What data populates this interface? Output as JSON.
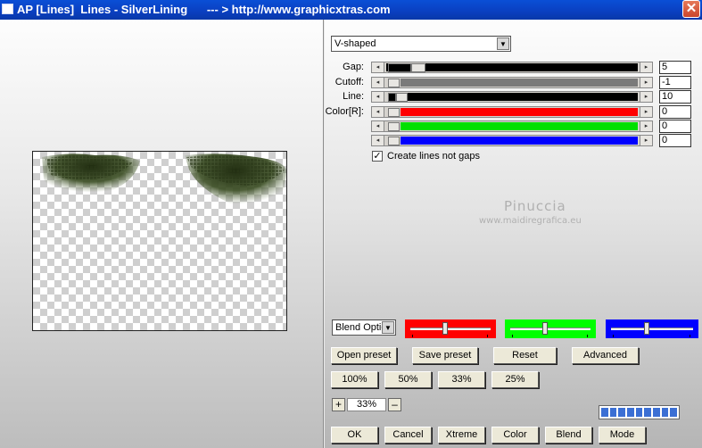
{
  "window": {
    "title": "AP [Lines]  Lines - SilverLining      --- > http://www.graphicxtras.com",
    "close_glyph": "✕"
  },
  "mode_select": {
    "value": "V-shaped"
  },
  "sliders": [
    {
      "label": "Gap:",
      "value": "5",
      "fill": "#000000"
    },
    {
      "label": "Cutoff:",
      "value": "-1",
      "fill": "#7a7a7a"
    },
    {
      "label": "Line:",
      "value": "10",
      "fill": "#000000"
    },
    {
      "label": "Color[R]:",
      "value": "0",
      "fill": "#ff0000"
    },
    {
      "label": "",
      "value": "0",
      "fill": "#00e000"
    },
    {
      "label": "",
      "value": "0",
      "fill": "#0000ff"
    }
  ],
  "create_lines_checkbox": {
    "checked": true,
    "label": "Create lines not gaps"
  },
  "watermark": {
    "name": "Pinuccia",
    "url": "www.maidiregrafica.eu"
  },
  "blend_select": {
    "value": "Blend Optio"
  },
  "color_panels": [
    {
      "color": "#ff0000",
      "level": 0.47
    },
    {
      "color": "#00ff00",
      "level": 0.47
    },
    {
      "color": "#0000ff",
      "level": 0.47
    }
  ],
  "preset_buttons": {
    "open": "Open preset",
    "save": "Save preset",
    "reset": "Reset",
    "advanced": "Advanced"
  },
  "zoom_buttons": [
    "100%",
    "50%",
    "33%",
    "25%"
  ],
  "zoom_control": {
    "plus": "+",
    "value": "33%",
    "minus": "–"
  },
  "progress": {
    "segments": 9
  },
  "bottom_buttons": {
    "ok": "OK",
    "cancel": "Cancel",
    "xtreme": "Xtreme",
    "color": "Color",
    "blend": "Blend",
    "mode": "Mode"
  },
  "colors": {
    "titlebar": "#0a3fc0",
    "foliage": "#2f3f1a",
    "progress": "#3b6fd4"
  }
}
